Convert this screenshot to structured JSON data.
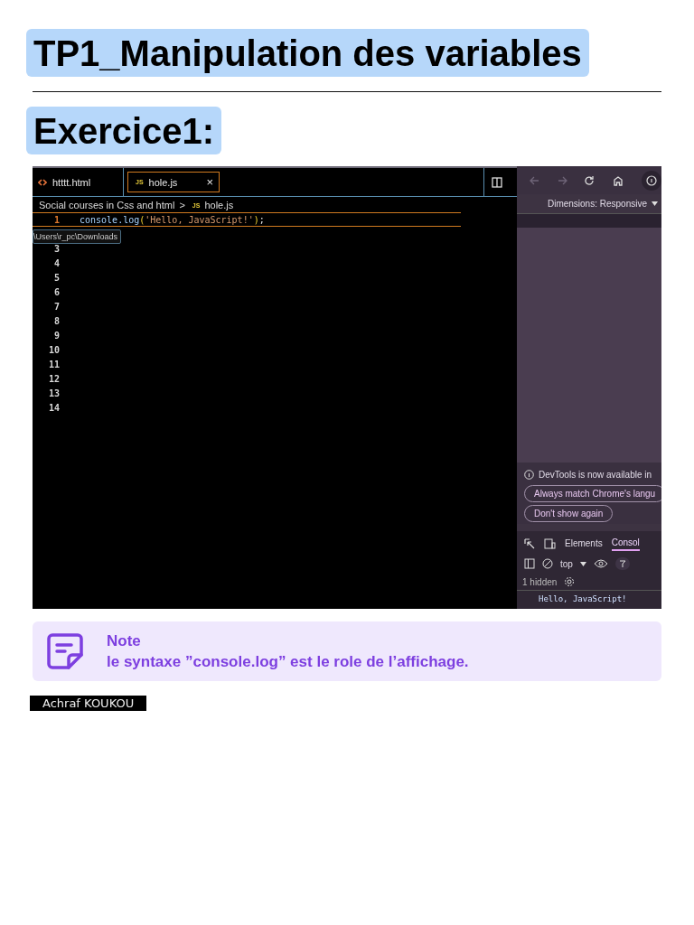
{
  "title": "TP1_Manipulation des variables",
  "heading": "Exercice1:",
  "editor": {
    "tabs": [
      {
        "label": "htttt.html",
        "kind": "html",
        "selected": false
      },
      {
        "label": "hole.js",
        "kind": "js",
        "badge": "JS",
        "close": "×",
        "selected": true
      }
    ],
    "breadcrumb": {
      "folder": "Social courses in Css and html",
      "separator": ">",
      "badge": "JS",
      "file": "hole.js"
    },
    "lines": [
      {
        "number": "1",
        "current": true,
        "tokens": [
          {
            "text": "console.log",
            "kind": "name"
          },
          {
            "text": "(",
            "kind": "paren"
          },
          {
            "text": "'Hello, JavaScript!'",
            "kind": "string"
          },
          {
            "text": ")",
            "kind": "paren"
          },
          {
            "text": ";",
            "kind": "plain"
          }
        ]
      },
      {
        "current": false
      },
      {
        "number": "3",
        "current": false
      },
      {
        "number": "4",
        "current": false
      },
      {
        "number": "5",
        "current": false
      },
      {
        "number": "6",
        "current": false
      },
      {
        "number": "7",
        "current": false
      },
      {
        "number": "8",
        "current": false
      },
      {
        "number": "9",
        "current": false
      },
      {
        "number": "10",
        "current": false
      },
      {
        "number": "11",
        "current": false
      },
      {
        "number": "12",
        "current": false
      },
      {
        "number": "13",
        "current": false
      },
      {
        "number": "14",
        "current": false
      }
    ],
    "tooltip": "\\Users\\r_pc\\Downloads"
  },
  "devtools": {
    "dimensions": "Dimensions: Responsive",
    "notice": "DevTools is now available in",
    "buttons": [
      "Always match Chrome's langu",
      "Don't show again"
    ],
    "tabs": [
      {
        "label": "Elements",
        "selected": false
      },
      {
        "label": "Consol",
        "selected": true
      }
    ],
    "context": "top",
    "hidden": "1 hidden",
    "output": "Hello, JavaScript!"
  },
  "note": {
    "title": "Note",
    "text": "le syntaxe ”console.log” est le role de l’affichage."
  },
  "author": "Achraf KOUKOU"
}
